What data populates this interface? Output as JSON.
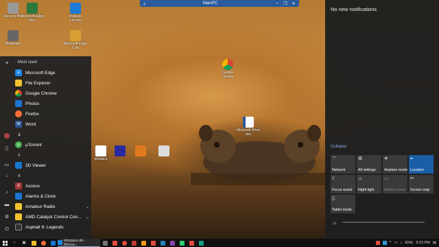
{
  "remote_session": {
    "title": "MainPC"
  },
  "desktop_icons": [
    {
      "label": "Google Chrome",
      "color": "#ffffff"
    },
    {
      "label": "Microsoft Word doc",
      "color": "#2b5797"
    },
    {
      "label": "ebspace",
      "color": "#ffffff"
    },
    {
      "label": "Microsoft Edge Dev",
      "color": "#2b7a3c"
    },
    {
      "label": "Imgburn Chrome",
      "color": "#1c7bd6"
    },
    {
      "label": "Bloatware",
      "color": "#444"
    },
    {
      "label": "Microsoft Edge Can",
      "color": "#d9a032"
    },
    {
      "label": "Recycle Bin",
      "color": "#888"
    }
  ],
  "start_menu": {
    "most_used_header": "Most used",
    "most_used": [
      {
        "label": "Microsoft Edge",
        "icon": "edge-icon",
        "color": "#1e88e5"
      },
      {
        "label": "File Explorer",
        "icon": "folder-icon",
        "color": "#f2c12e"
      },
      {
        "label": "Google Chrome",
        "icon": "chrome-icon",
        "color": "#e74c3c"
      },
      {
        "label": "Photos",
        "icon": "photos-icon",
        "color": "#1976d2"
      },
      {
        "label": "Firefox",
        "icon": "firefox-icon",
        "color": "#ff7139"
      },
      {
        "label": "Word",
        "icon": "word-icon",
        "color": "#2b5797"
      }
    ],
    "groups": [
      {
        "header": "&",
        "items": [
          {
            "label": "µTorrent",
            "color": "#4caf50",
            "chevron": false
          }
        ]
      },
      {
        "header": "#",
        "items": [
          {
            "label": "3D Viewer",
            "color": "#1976d2",
            "chevron": false
          }
        ]
      },
      {
        "header": "A",
        "items": [
          {
            "label": "Access",
            "color": "#a4373a",
            "chevron": false
          },
          {
            "label": "Alarms & Clock",
            "color": "#1976d2",
            "chevron": false
          },
          {
            "label": "Amateur Radio",
            "color": "#f2c12e",
            "chevron": true
          },
          {
            "label": "AMD Catalyst Control Cen...",
            "color": "#f2c12e",
            "chevron": true
          },
          {
            "label": "Asphalt 9: Legends",
            "color": "#333",
            "chevron": false
          }
        ]
      }
    ]
  },
  "action_center": {
    "no_notifications": "No new notifications",
    "collapse": "Collapse",
    "tiles": [
      {
        "label": "Network",
        "icon": "network-icon",
        "active": false,
        "dim": false
      },
      {
        "label": "All settings",
        "icon": "gear-icon",
        "active": false,
        "dim": false
      },
      {
        "label": "Airplane mode",
        "icon": "airplane-icon",
        "active": false,
        "dim": false
      },
      {
        "label": "Location",
        "icon": "location-icon",
        "active": true,
        "dim": false
      },
      {
        "label": "Focus assist",
        "icon": "moon-icon",
        "active": false,
        "dim": false
      },
      {
        "label": "Night light",
        "icon": "nightlight-icon",
        "active": false,
        "dim": false
      },
      {
        "label": "Battery saver",
        "icon": "battery-icon",
        "active": false,
        "dim": true
      },
      {
        "label": "Screen snip",
        "icon": "scissors-icon",
        "active": false,
        "dim": false
      },
      {
        "label": "Tablet mode",
        "icon": "tablet-icon",
        "active": false,
        "dim": false
      }
    ],
    "brightness": 0.0
  },
  "taskbar": {
    "active_window_label": "ebspace.de - Micros...",
    "language": "ENG",
    "time": "5:23 PM"
  }
}
